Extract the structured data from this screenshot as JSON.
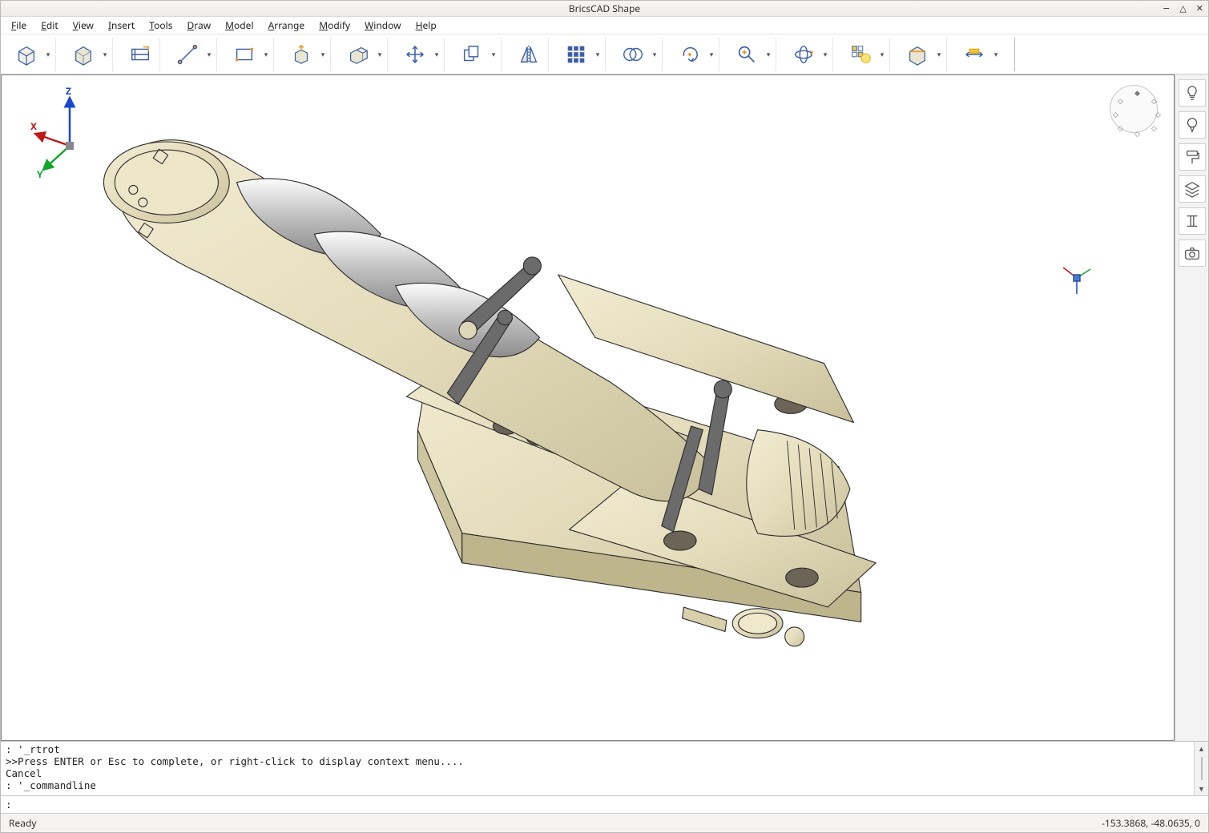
{
  "app": {
    "title": "BricsCAD Shape"
  },
  "menu": {
    "file": "File",
    "edit": "Edit",
    "view": "View",
    "insert": "Insert",
    "tools": "Tools",
    "draw": "Draw",
    "model": "Model",
    "arrange": "Arrange",
    "modify": "Modify",
    "window": "Window",
    "help": "Help"
  },
  "toolbar": {
    "items": [
      {
        "name": "box-tool",
        "tip": "Box"
      },
      {
        "name": "cylinder-tool",
        "tip": "Solid primitive"
      },
      {
        "name": "component-tool",
        "tip": "Insert component"
      },
      {
        "name": "line-tool",
        "tip": "Line"
      },
      {
        "name": "rectangle-tool",
        "tip": "Rectangle"
      },
      {
        "name": "pushpull-tool",
        "tip": "Push/Pull"
      },
      {
        "name": "extrude-tool",
        "tip": "Extrude"
      },
      {
        "name": "move-tool",
        "tip": "Move"
      },
      {
        "name": "copy-tool",
        "tip": "Copy"
      },
      {
        "name": "mirror-tool",
        "tip": "Mirror"
      },
      {
        "name": "array-tool",
        "tip": "Array"
      },
      {
        "name": "union-tool",
        "tip": "Boolean"
      },
      {
        "name": "rotate-tool",
        "tip": "Rotate"
      },
      {
        "name": "zoom-tool",
        "tip": "Zoom"
      },
      {
        "name": "orbit-tool",
        "tip": "Orbit"
      },
      {
        "name": "visual-style-tool",
        "tip": "Visual style"
      },
      {
        "name": "section-tool",
        "tip": "Section"
      },
      {
        "name": "dimension-tool",
        "tip": "Dimension"
      }
    ]
  },
  "rightbar": {
    "items": [
      {
        "name": "tips-icon"
      },
      {
        "name": "sky-icon"
      },
      {
        "name": "materials-icon"
      },
      {
        "name": "layers-icon"
      },
      {
        "name": "structure-icon"
      },
      {
        "name": "camera-icon"
      }
    ]
  },
  "axes": {
    "x": "X",
    "y": "Y",
    "z": "Z"
  },
  "command": {
    "history_line1": ": '_rtrot",
    "history_line2": ">>Press ENTER or Esc to complete, or right-click to display context menu....",
    "history_line3": "Cancel",
    "history_line4": ": '_commandline",
    "prompt": ":",
    "input_value": ""
  },
  "status": {
    "left": "Ready",
    "right": "-153.3868, -48.0635, 0"
  }
}
